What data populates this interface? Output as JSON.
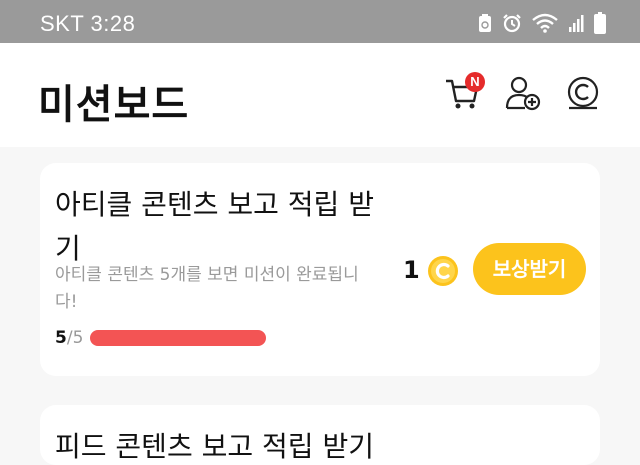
{
  "status_bar": {
    "carrier_time": "SKT  3:28",
    "icons": [
      "recycle-icon",
      "alarm-icon",
      "wifi-icon",
      "signal-icon",
      "battery-icon"
    ]
  },
  "header": {
    "title": "미션보드",
    "cart_badge": "N",
    "icons": [
      "cart-icon",
      "add-friend-icon",
      "coin-icon"
    ]
  },
  "missions": [
    {
      "title": "아티클 콘텐츠 보고 적립 받기",
      "description": "아티클 콘텐츠 5개를 보면 미션이 완료됩니다!",
      "progress_current": "5",
      "progress_total": "/5",
      "progress_fraction": 1.0,
      "reward_amount": "1",
      "reward_button": "보상받기"
    },
    {
      "title": "피드 콘텐츠 보고 적립 받기"
    }
  ],
  "colors": {
    "status_bar": "#9a9a9a",
    "accent_yellow": "#fcc31c",
    "progress_red": "#f35454",
    "badge_red": "#e52b2b"
  }
}
